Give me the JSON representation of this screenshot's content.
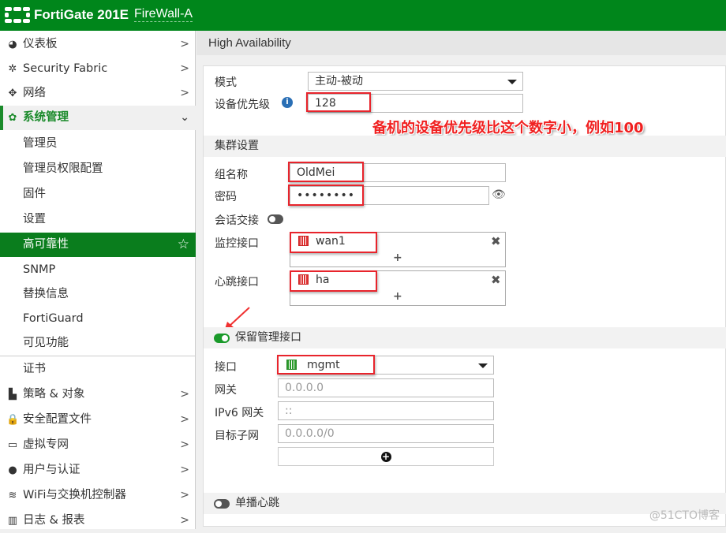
{
  "header": {
    "product": "FortiGate 201E",
    "hostname": "FireWall-A",
    "brand_color": "#00861b"
  },
  "sidebar": {
    "items": [
      {
        "label": "仪表板",
        "icon": "dashboard-icon",
        "chevron": ">"
      },
      {
        "label": "Security Fabric",
        "icon": "fabric-icon",
        "chevron": ">"
      },
      {
        "label": "网络",
        "icon": "network-icon",
        "chevron": ">"
      },
      {
        "label": "系统管理",
        "icon": "gear-icon",
        "chevron": "⌄"
      },
      {
        "label": "管理员"
      },
      {
        "label": "管理员权限配置"
      },
      {
        "label": "固件"
      },
      {
        "label": "设置"
      },
      {
        "label": "高可靠性",
        "star": "☆"
      },
      {
        "label": "SNMP"
      },
      {
        "label": "替换信息"
      },
      {
        "label": "FortiGuard"
      },
      {
        "label": "可见功能"
      },
      {
        "label": "证书"
      },
      {
        "label": "策略 & 对象",
        "icon": "policy-icon",
        "chevron": ">"
      },
      {
        "label": "安全配置文件",
        "icon": "lock-icon",
        "chevron": ">"
      },
      {
        "label": "虚拟专网",
        "icon": "vpn-icon",
        "chevron": ">"
      },
      {
        "label": "用户与认证",
        "icon": "user-icon",
        "chevron": ">"
      },
      {
        "label": "WiFi与交换机控制器",
        "icon": "wifi-icon",
        "chevron": ">"
      },
      {
        "label": "日志 & 报表",
        "icon": "chart-icon",
        "chevron": ">"
      }
    ]
  },
  "page": {
    "title": "High Availability"
  },
  "form": {
    "mode_label": "模式",
    "mode_value": "主动-被动",
    "priority_label": "设备优先级",
    "priority_value": "128",
    "cluster_section": "集群设置",
    "group_label": "组名称",
    "group_value": "OldMei",
    "password_label": "密码",
    "password_value": "••••••••",
    "session_label": "会话交接",
    "monitor_label": "监控接口",
    "monitor_value": "wan1",
    "heartbeat_label": "心跳接口",
    "heartbeat_value": "ha",
    "reserve_section": "保留管理接口",
    "iface_label": "接口",
    "iface_value": "mgmt",
    "gateway_label": "网关",
    "gateway_placeholder": "0.0.0.0",
    "ipv6_label": "IPv6 网关",
    "ipv6_placeholder": "::",
    "subnet_label": "目标子网",
    "subnet_placeholder": "0.0.0.0/0",
    "unicast_label": "单播心跳"
  },
  "annotation": {
    "note": "备机的设备优先级比这个数字小，例如100"
  },
  "watermark": "@51CTO博客"
}
